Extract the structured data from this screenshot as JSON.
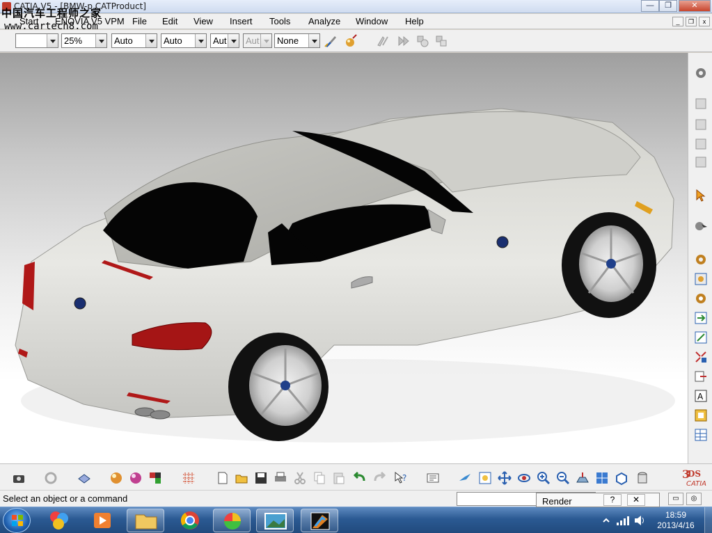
{
  "window": {
    "title": "CATIA V5 - [BMW-p.CATProduct]",
    "watermark_cn": "中国汽车工程师之家",
    "watermark_url": "www.cartech8.com",
    "controls": {
      "minimize": "—",
      "restore": "❐",
      "close": "✕"
    }
  },
  "menubar": {
    "items": [
      {
        "label": "Start"
      },
      {
        "label": "ENOVIA V5 VPM"
      },
      {
        "label": "File"
      },
      {
        "label": "Edit"
      },
      {
        "label": "View"
      },
      {
        "label": "Insert"
      },
      {
        "label": "Tools"
      },
      {
        "label": "Analyze"
      },
      {
        "label": "Window"
      },
      {
        "label": "Help"
      }
    ],
    "doc_controls": {
      "minimize": "_",
      "restore": "❐",
      "close": "x"
    }
  },
  "toolbar": {
    "combos": [
      {
        "value": ""
      },
      {
        "value": "25%"
      },
      {
        "value": "Auto"
      },
      {
        "value": "Auto"
      },
      {
        "value": "Aut"
      },
      {
        "value": "Aut"
      },
      {
        "value": "None"
      }
    ]
  },
  "statusbar": {
    "message": "Select an object or a command",
    "command_input": "",
    "render_popup": {
      "label": "Render",
      "help": "?",
      "close": "✕"
    }
  },
  "taskbar": {
    "time": "18:59",
    "date": "2013/4/16"
  },
  "colors": {
    "accent_catia": "#c0392b",
    "taskbar": "#2b5a93",
    "car_body": "#e6e6e2",
    "glass": "#050505"
  },
  "icons": {
    "toolbar": [
      "paint-brush-icon",
      "apply-material-icon",
      "select-linked-icon",
      "fast-forward-icon",
      "assembly-icon-a",
      "assembly-icon-b"
    ],
    "right": [
      "gear-icon",
      "product-icon-1",
      "product-icon-2",
      "product-icon-3",
      "product-icon-4",
      "select-arrow-icon",
      "manipulate-icon",
      "gear-icon-2",
      "component-icon",
      "insert-component-icon",
      "move-icon",
      "snap-icon",
      "explode-icon",
      "constraint-icon",
      "annotation-icon",
      "catalog-icon",
      "table-icon"
    ],
    "bottom": [
      "camera-icon",
      "refresh-icon",
      "layer-icon",
      "sphere-icon-a",
      "sphere-icon-b",
      "blocks-icon",
      "grid-icon",
      "new-icon",
      "open-icon",
      "save-icon",
      "print-icon",
      "cut-icon",
      "copy-icon",
      "paste-icon",
      "undo-icon",
      "redo-icon",
      "whats-this-icon",
      "fly-mode-icon",
      "fit-all-icon",
      "pan-icon",
      "rotate-icon",
      "zoom-in-icon",
      "zoom-out-icon",
      "normal-view-icon",
      "multi-view-icon",
      "iso-view-icon",
      "render-style-icon",
      "3ds-catia-logo"
    ]
  }
}
